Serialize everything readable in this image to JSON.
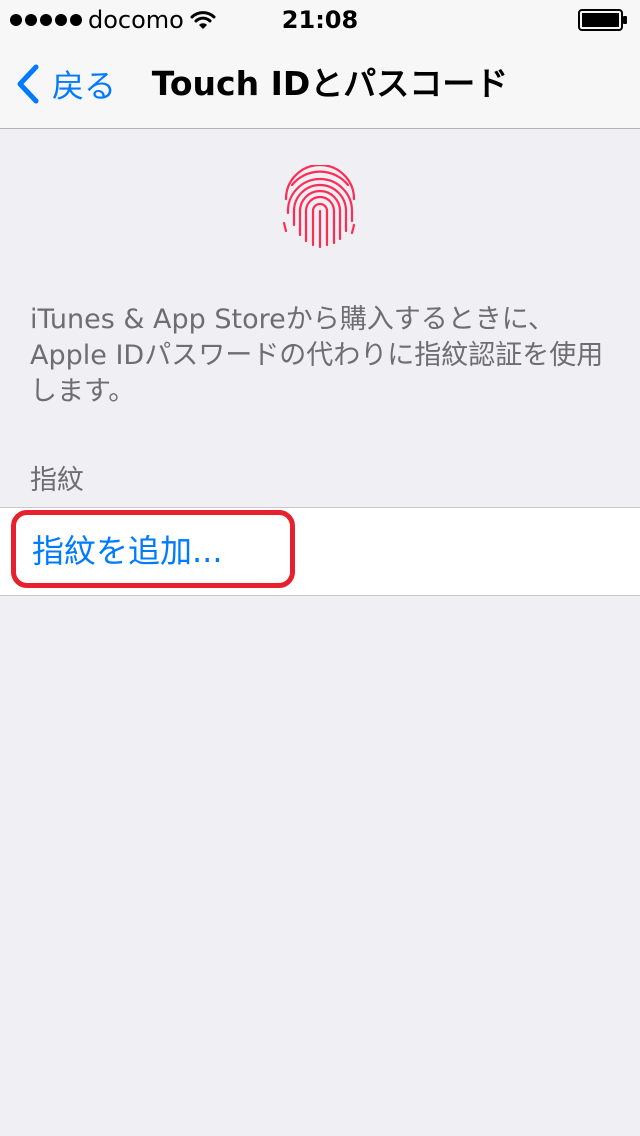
{
  "status_bar": {
    "carrier": "docomo",
    "time": "21:08",
    "signal_bars": 5
  },
  "nav": {
    "back_label": "戻る",
    "title": "Touch IDとパスコード"
  },
  "description": "iTunes & App Storeから購入するときに、Apple IDパスワードの代わりに指紋認証を使用します。",
  "section": {
    "header": "指紋",
    "add_button_label": "指紋を追加..."
  },
  "colors": {
    "accent": "#007aff",
    "fingerprint": "#ff2d55",
    "highlight": "#e8202e"
  }
}
